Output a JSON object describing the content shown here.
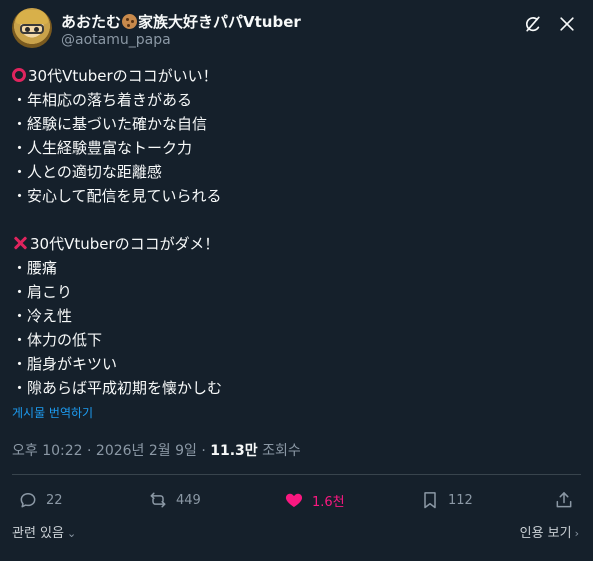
{
  "author": {
    "name_prefix": "あおたむ",
    "name_suffix": "家族大好きパパVtuber",
    "handle": "@aotamu_papa"
  },
  "post": {
    "good_header": "30代Vtuberのココがいい！",
    "good_items": [
      "・年相応の落ち着きがある",
      "・経験に基づいた確かな自信",
      "・人生経験豊富なトーク力",
      "・人との適切な距離感",
      "・安心して配信を見ていられる"
    ],
    "bad_header": "30代Vtuberのココがダメ！",
    "bad_items": [
      "・腰痛",
      "・肩こり",
      "・冷え性",
      "・体力の低下",
      "・脂身がキツい",
      "・隙あらば平成初期を懐かしむ"
    ],
    "translate_label": "게시물 번역하기"
  },
  "meta": {
    "timestamp": "오후 10:22 · 2026년 2월 9일 · ",
    "views_count": "11.3만",
    "views_label": " 조회수"
  },
  "actions": {
    "replies": "22",
    "reposts": "449",
    "likes": "1.6천",
    "bookmarks": "112"
  },
  "footer": {
    "related_label": "관련 있음",
    "quotes_label": "인용 보기"
  },
  "colors": {
    "background": "#15202b",
    "accent_blue": "#1d9bf0",
    "like_pink": "#f91880",
    "muted": "#8b98a5"
  },
  "icons": [
    "grok-icon",
    "more-icon",
    "reply-icon",
    "repost-icon",
    "heart-icon",
    "bookmark-icon",
    "share-icon"
  ]
}
